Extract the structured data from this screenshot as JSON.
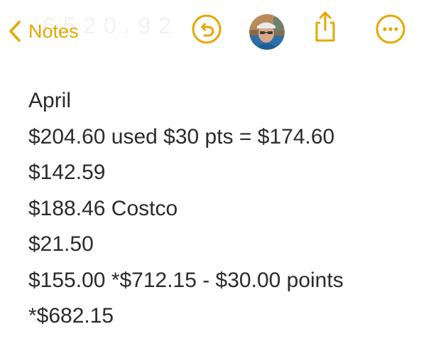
{
  "nav": {
    "back_label": "Notes",
    "ghost_text": "6 5 2 0 . 9 2",
    "accent_color": "#e5a800",
    "icons": [
      "chevron-left-icon",
      "undo-icon",
      "avatar",
      "share-icon",
      "more-icon"
    ]
  },
  "note": {
    "lines": [
      "April",
      "$204.60 used $30 pts = $174.60",
      "$142.59",
      "$188.46 Costco",
      "$21.50",
      "$155.00 *$712.15 - $30.00 points",
      "*$682.15"
    ]
  }
}
